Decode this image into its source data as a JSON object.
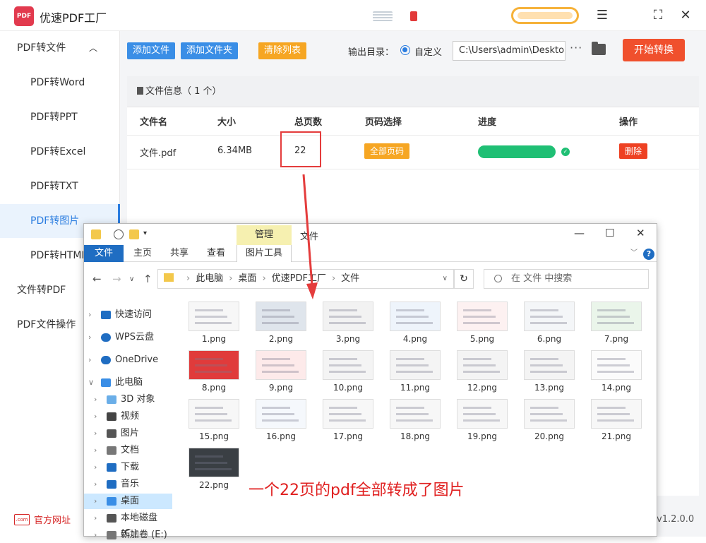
{
  "app": {
    "title": "优速PDF工厂",
    "logo_text": "PDF",
    "version": "v1.2.0.0",
    "footer_link": "官方网址",
    "footer_icon_text": ".com"
  },
  "sidebar": {
    "groups": [
      {
        "label": "PDF转文件",
        "items": [
          "PDF转Word",
          "PDF转PPT",
          "PDF转Excel",
          "PDF转TXT",
          "PDF转图片",
          "PDF转HTML"
        ]
      },
      {
        "label": "文件转PDF"
      },
      {
        "label": "PDF文件操作"
      }
    ],
    "active": "PDF转图片"
  },
  "toolbar": {
    "add_file": "添加文件",
    "add_folder": "添加文件夹",
    "clear_list": "清除列表",
    "output_label": "输出目录：",
    "custom_label": "自定义",
    "output_path": "C:\\Users\\admin\\Desktop",
    "more": "···",
    "start": "开始转换"
  },
  "table": {
    "header": "文件信息（ 1 个）",
    "columns": [
      "文件名",
      "大小",
      "总页数",
      "页码选择",
      "进度",
      "操作"
    ],
    "row": {
      "name": "文件.pdf",
      "size": "6.34MB",
      "pages": "22",
      "page_select": "全部页码",
      "progress": 1.0,
      "action": "删除"
    }
  },
  "explorer": {
    "manage_tab": "管理",
    "window_title": "文件",
    "ribbon_tabs": [
      "文件",
      "主页",
      "共享",
      "查看",
      "图片工具"
    ],
    "path": [
      "此电脑",
      "桌面",
      "优速PDF工厂",
      "文件"
    ],
    "search_placeholder": "在 文件 中搜索",
    "tree": [
      "快速访问",
      "WPS云盘",
      "OneDrive",
      "此电脑",
      "3D 对象",
      "视频",
      "图片",
      "文档",
      "下载",
      "音乐",
      "桌面",
      "本地磁盘 (C:)",
      "新加卷 (E:)"
    ],
    "selected_tree": "桌面",
    "files": [
      "1.png",
      "2.png",
      "3.png",
      "4.png",
      "5.png",
      "6.png",
      "7.png",
      "8.png",
      "9.png",
      "10.png",
      "11.png",
      "12.png",
      "13.png",
      "14.png",
      "15.png",
      "16.png",
      "17.png",
      "18.png",
      "19.png",
      "20.png",
      "21.png",
      "22.png"
    ]
  },
  "annotation": "一个22页的pdf全部转成了图片",
  "colors": {
    "accent_blue": "#3a8ee6",
    "orange": "#f6a623",
    "start_red": "#f0502d",
    "progress_green": "#1fbf74",
    "annotation_red": "#e02020"
  }
}
